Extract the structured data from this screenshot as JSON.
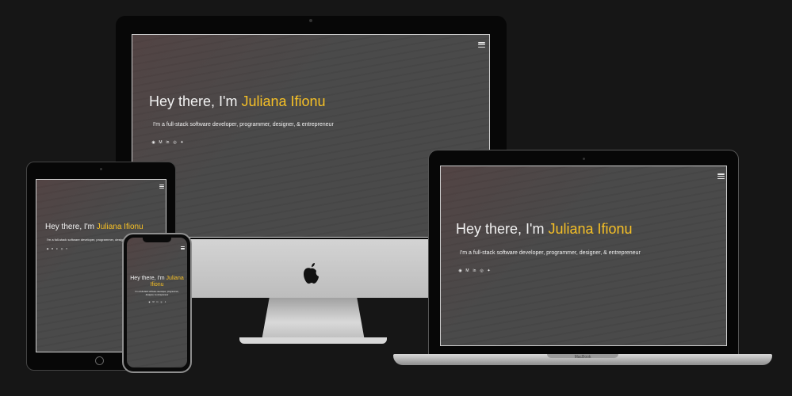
{
  "site": {
    "greeting": "Hey there, I'm ",
    "name": "Juliana Ifionu",
    "tagline": "I'm a full-stack software developer, programmer, designer, & entrepreneur",
    "menu_icon": "hamburger-menu-icon",
    "social_icons": [
      "github-icon",
      "medium-icon",
      "linkedin-icon",
      "instagram-icon",
      "twitter-icon"
    ],
    "social_glyphs": [
      "◉",
      "M",
      "in",
      "◎",
      "✦"
    ]
  },
  "laptop": {
    "brand": "MacBook"
  },
  "colors": {
    "accent": "#f6c026",
    "text": "#f2f2f2",
    "screen": "#4a4a4a",
    "page_bg": "#161616"
  }
}
